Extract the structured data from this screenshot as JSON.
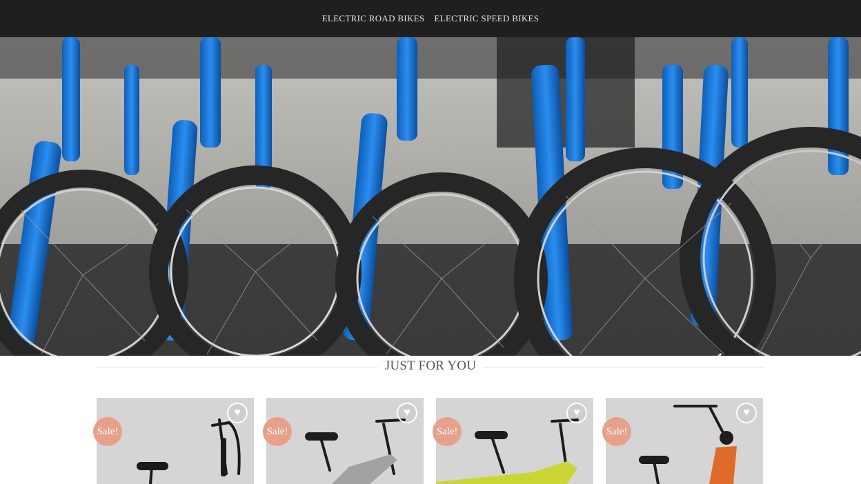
{
  "nav": {
    "items": [
      {
        "label": "ELECTRIC ROAD BIKES"
      },
      {
        "label": "ELECTRIC SPEED BIKES"
      }
    ]
  },
  "hero": {
    "icon": "bicycle-row-photo"
  },
  "section": {
    "title": "JUST FOR YOU"
  },
  "products": [
    {
      "badge": "Sale!",
      "wishlist_icon": "heart-icon",
      "frame_color": "#1a1a1a"
    },
    {
      "badge": "Sale!",
      "wishlist_icon": "heart-icon",
      "frame_color": "#9fa1a3"
    },
    {
      "badge": "Sale!",
      "wishlist_icon": "heart-icon",
      "frame_color": "#c9d633"
    },
    {
      "badge": "Sale!",
      "wishlist_icon": "heart-icon",
      "frame_color": "#e06a2a"
    }
  ],
  "colors": {
    "topbar": "#1f1f1f",
    "sale_badge": "#e8a08a",
    "card_bg": "#d5d5d5"
  }
}
